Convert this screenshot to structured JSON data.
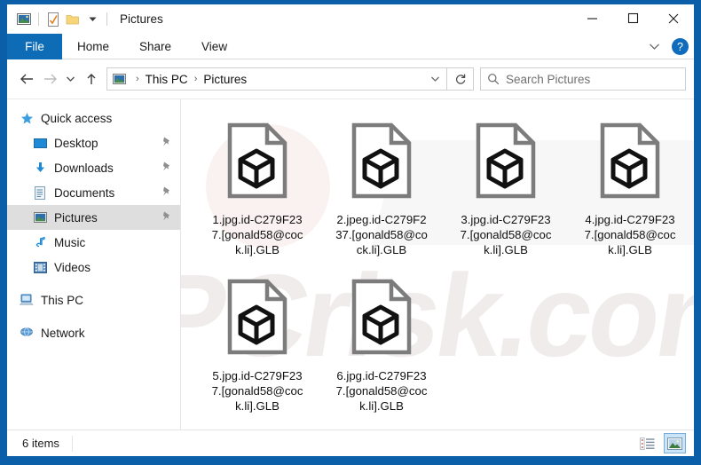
{
  "window": {
    "title": "Pictures",
    "quick_access_icons": [
      "picture-icon",
      "properties-icon",
      "new-folder-icon",
      "customize-dropdown-icon"
    ],
    "controls": {
      "minimize": "minimize-icon",
      "maximize": "maximize-icon",
      "close": "close-icon"
    }
  },
  "ribbon": {
    "tabs": [
      {
        "label": "File",
        "selected": true
      },
      {
        "label": "Home",
        "selected": false
      },
      {
        "label": "Share",
        "selected": false
      },
      {
        "label": "View",
        "selected": false
      }
    ],
    "collapse_icon": "chevron-down-icon",
    "help_label": "?"
  },
  "address": {
    "back_icon": "arrow-left-icon",
    "forward_icon": "arrow-right-icon",
    "recent_icon": "chevron-down-icon",
    "up_icon": "arrow-up-icon",
    "path_icon": "pictures-folder-icon",
    "crumbs": [
      "This PC",
      "Pictures"
    ],
    "separator": "›",
    "dropdown_icon": "chevron-down-icon",
    "refresh_icon": "refresh-icon"
  },
  "search": {
    "icon": "search-icon",
    "placeholder": "Search Pictures"
  },
  "sidebar": {
    "items": [
      {
        "label": "Quick access",
        "icon": "star-icon",
        "level": 0,
        "pinned": false,
        "selected": false
      },
      {
        "label": "Desktop",
        "icon": "desktop-icon",
        "level": 1,
        "pinned": true,
        "selected": false
      },
      {
        "label": "Downloads",
        "icon": "downloads-icon",
        "level": 1,
        "pinned": true,
        "selected": false
      },
      {
        "label": "Documents",
        "icon": "documents-icon",
        "level": 1,
        "pinned": true,
        "selected": false
      },
      {
        "label": "Pictures",
        "icon": "pictures-icon",
        "level": 1,
        "pinned": true,
        "selected": true
      },
      {
        "label": "Music",
        "icon": "music-icon",
        "level": 1,
        "pinned": false,
        "selected": false
      },
      {
        "label": "Videos",
        "icon": "videos-icon",
        "level": 1,
        "pinned": false,
        "selected": false
      },
      {
        "label": "This PC",
        "icon": "this-pc-icon",
        "level": 0,
        "pinned": false,
        "selected": false
      },
      {
        "label": "Network",
        "icon": "network-icon",
        "level": 0,
        "pinned": false,
        "selected": false
      }
    ]
  },
  "files": [
    {
      "name": "1.jpg.id-C279F237.[gonald58@cock.li].GLB",
      "icon": "glb-3d-model-file-icon"
    },
    {
      "name": "2.jpeg.id-C279F237.[gonald58@cock.li].GLB",
      "icon": "glb-3d-model-file-icon"
    },
    {
      "name": "3.jpg.id-C279F237.[gonald58@cock.li].GLB",
      "icon": "glb-3d-model-file-icon"
    },
    {
      "name": "4.jpg.id-C279F237.[gonald58@cock.li].GLB",
      "icon": "glb-3d-model-file-icon"
    },
    {
      "name": "5.jpg.id-C279F237.[gonald58@cock.li].GLB",
      "icon": "glb-3d-model-file-icon"
    },
    {
      "name": "6.jpg.id-C279F237.[gonald58@cock.li].GLB",
      "icon": "glb-3d-model-file-icon"
    }
  ],
  "status": {
    "item_count": "6 items",
    "views": [
      {
        "name": "details-view",
        "selected": false
      },
      {
        "name": "large-icons-view",
        "selected": true
      }
    ]
  },
  "watermark": {
    "text": "PCrisk.com"
  },
  "colors": {
    "desktop_blue": "#0b5ea8",
    "file_tab_blue": "#0d6cb5",
    "selection_gray": "#dedede",
    "view_active_blue": "#cce4f7"
  }
}
